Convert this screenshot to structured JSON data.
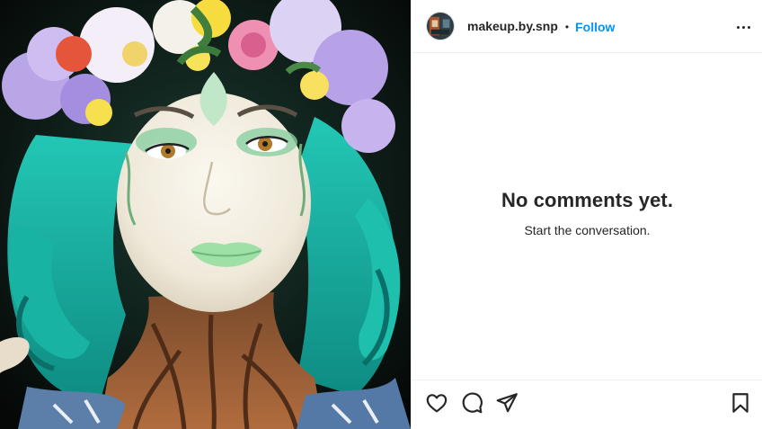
{
  "post": {
    "username": "makeup.by.snp",
    "separator": "•",
    "follow_label": "Follow"
  },
  "comments": {
    "empty_title": "No comments yet.",
    "empty_subtitle": "Start the conversation."
  },
  "icons": {
    "more": "more-options-icon",
    "like": "heart-icon",
    "comment": "comment-bubble-icon",
    "share": "paper-plane-icon",
    "save": "bookmark-icon"
  },
  "colors": {
    "link": "#0095f6",
    "text": "#262626",
    "divider": "#efefef"
  }
}
